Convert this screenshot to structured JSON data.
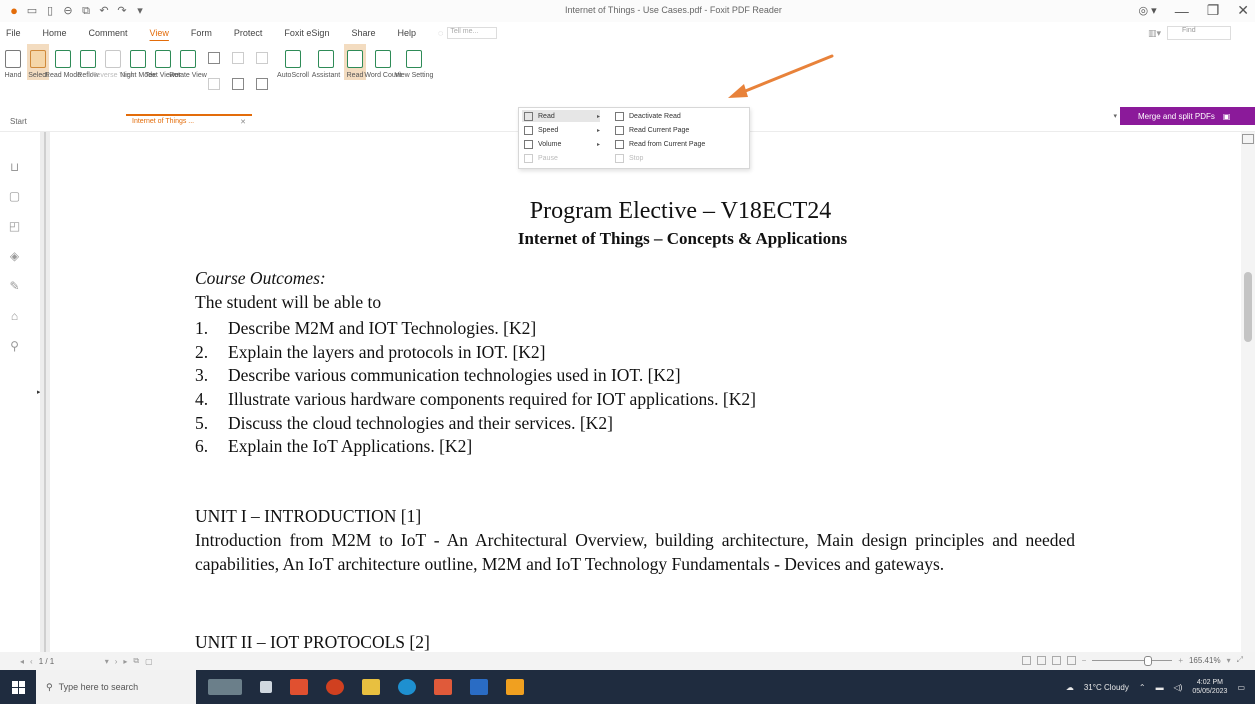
{
  "window": {
    "title": "Internet of Things - Use Cases.pdf - Foxit PDF Reader"
  },
  "menu": {
    "items": [
      "File",
      "Home",
      "Comment",
      "View",
      "Form",
      "Protect",
      "Foxit eSign",
      "Share",
      "Help"
    ],
    "active": "View",
    "tell_me_placeholder": "Tell me..."
  },
  "top_right": {
    "find_placeholder": "Find"
  },
  "ribbon": {
    "buttons": [
      {
        "label": "Hand",
        "icon": "hand-icon"
      },
      {
        "label": "Select",
        "icon": "select-icon"
      },
      {
        "label": "Read Mode",
        "icon": "read-mode-icon"
      },
      {
        "label": "Reflow",
        "icon": "reflow-icon"
      },
      {
        "label": "Reverse View",
        "icon": "reverse-view-icon"
      },
      {
        "label": "Night Mode",
        "icon": "night-mode-icon"
      },
      {
        "label": "Text Viewer",
        "icon": "text-viewer-icon"
      },
      {
        "label": "Rotate View",
        "icon": "rotate-view-icon"
      },
      {
        "label": "AutoScroll",
        "icon": "autoscroll-icon"
      },
      {
        "label": "Assistant",
        "icon": "assistant-icon"
      },
      {
        "label": "Read",
        "icon": "read-icon"
      },
      {
        "label": "Word Count",
        "icon": "word-count-icon"
      },
      {
        "label": "View Setting",
        "icon": "view-setting-icon"
      }
    ]
  },
  "read_dropdown": {
    "left": [
      {
        "label": "Read",
        "icon": "read-icon"
      },
      {
        "label": "Speed",
        "icon": "speed-icon"
      },
      {
        "label": "Volume",
        "icon": "volume-icon"
      },
      {
        "label": "Pause",
        "icon": "pause-icon"
      }
    ],
    "right": [
      {
        "label": "Deactivate Read",
        "icon": "deactivate-read-icon"
      },
      {
        "label": "Read Current Page",
        "icon": "read-page-icon"
      },
      {
        "label": "Read from Current Page",
        "icon": "read-from-page-icon"
      },
      {
        "label": "Stop",
        "icon": "stop-icon"
      }
    ]
  },
  "tabs": {
    "start": "Start",
    "document": "Internet of Things ..."
  },
  "merge_button": "Merge and split PDFs",
  "document": {
    "title": "Program Elective – V18ECT24",
    "subtitle": "Internet of Things – Concepts & Applications",
    "outcomes_heading": "Course Outcomes:",
    "intro_line": "The student will be able to",
    "outcomes": [
      {
        "num": "1.",
        "text": "Describe M2M and IOT Technologies. [K2]"
      },
      {
        "num": "2.",
        "text": "Explain the layers and protocols in IOT. [K2]"
      },
      {
        "num": "3.",
        "text": "Describe various communication technologies used in IOT. [K2]"
      },
      {
        "num": "4.",
        "text": "Illustrate various hardware components required for IOT applications. [K2]"
      },
      {
        "num": "5.",
        "text": "Discuss the cloud technologies and their services. [K2]"
      },
      {
        "num": "6.",
        "text": "Explain the IoT Applications. [K2]"
      }
    ],
    "unit1_heading": "UNIT I – INTRODUCTION [1]",
    "unit1_text": "Introduction from M2M to IoT - An Architectural Overview, building architecture, Main design principles and needed capabilities, An IoT architecture outline, M2M and IoT Technology Fundamentals - Devices and gateways.",
    "unit2_heading": "UNIT II – IOT PROTOCOLS [2]"
  },
  "statusbar": {
    "page": "1 / 1",
    "zoom": "165.41%"
  },
  "taskbar": {
    "search_placeholder": "Type here to search",
    "weather": "31°C Cloudy",
    "time": "4:02 PM",
    "date": "05/05/2023"
  },
  "colors": {
    "accent": "#e36c0a",
    "merge": "#8b1a9a",
    "taskbar": "#1f2c3f"
  }
}
